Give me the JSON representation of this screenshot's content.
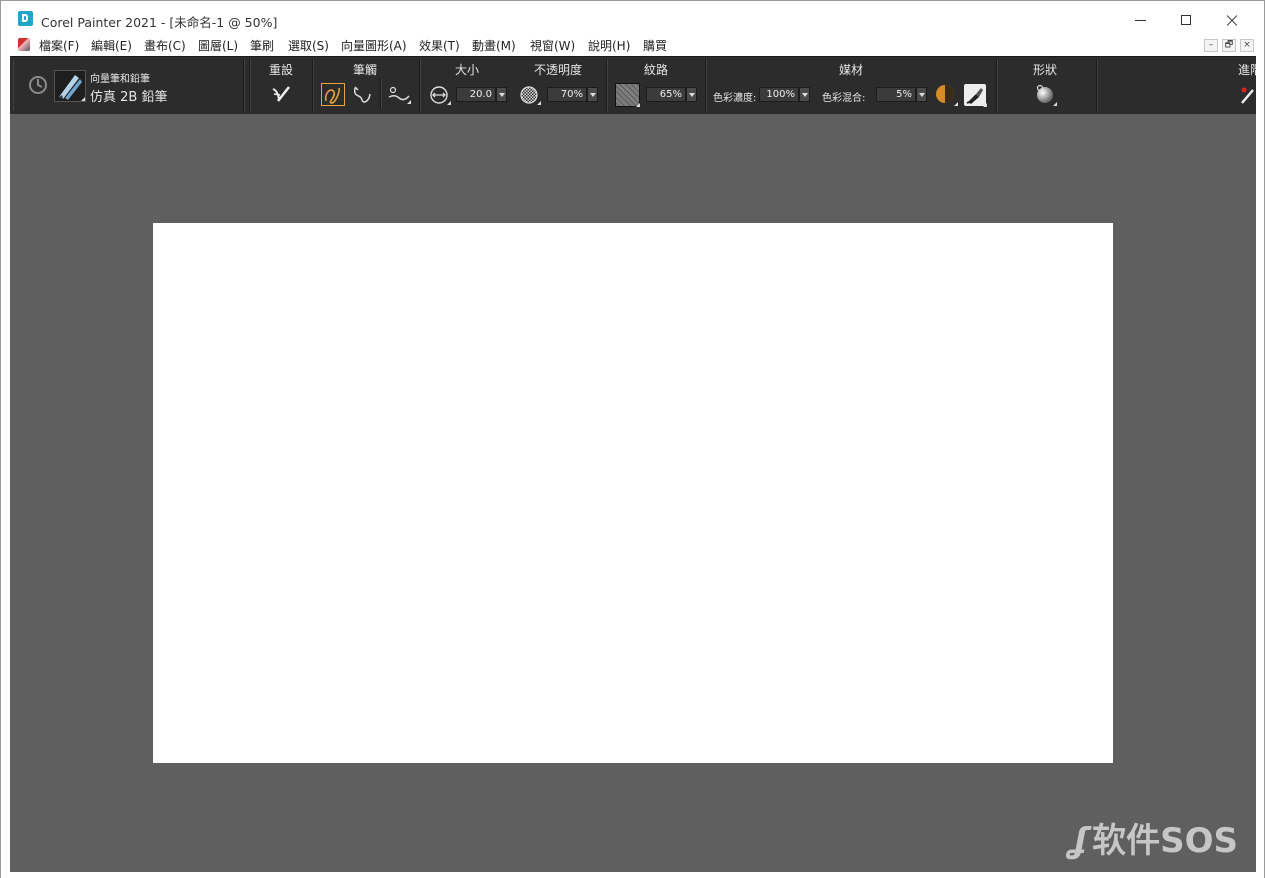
{
  "window": {
    "title": "Corel Painter 2021 - [未命名-1 @ 50%]"
  },
  "menubar": {
    "items": [
      "檔案(F)",
      "編輯(E)",
      "畫布(C)",
      "圖層(L)",
      "筆刷",
      "選取(S)",
      "向量圖形(A)",
      "效果(T)",
      "動畫(M)",
      "視窗(W)",
      "說明(H)",
      "購買"
    ],
    "mdi_buttons": [
      "–",
      "🗗",
      "×"
    ]
  },
  "propbar": {
    "brush_category": "向量筆和鉛筆",
    "brush_variant": "仿真 2B 鉛筆",
    "reset_label": "重設",
    "stroke_label": "筆觸",
    "size_label": "大小",
    "size_value": "20.0",
    "opacity_label": "不透明度",
    "opacity_value": "70%",
    "grain_label": "紋路",
    "grain_value": "65%",
    "media_label": "媒材",
    "resaturation_label": "色彩濃度:",
    "resaturation_value": "100%",
    "bleed_label": "色彩混合:",
    "bleed_value": "5%",
    "shape_label": "形狀",
    "advanced_label": "進階"
  },
  "watermark": {
    "text": "软件SOS"
  },
  "colors": {
    "propbar_bg": "#2c2c2c",
    "workspace_bg": "#5f5f5f",
    "canvas_bg": "#ffffff",
    "accent_orange": "#e8a33b",
    "app_logo": "#1fa7c9"
  }
}
